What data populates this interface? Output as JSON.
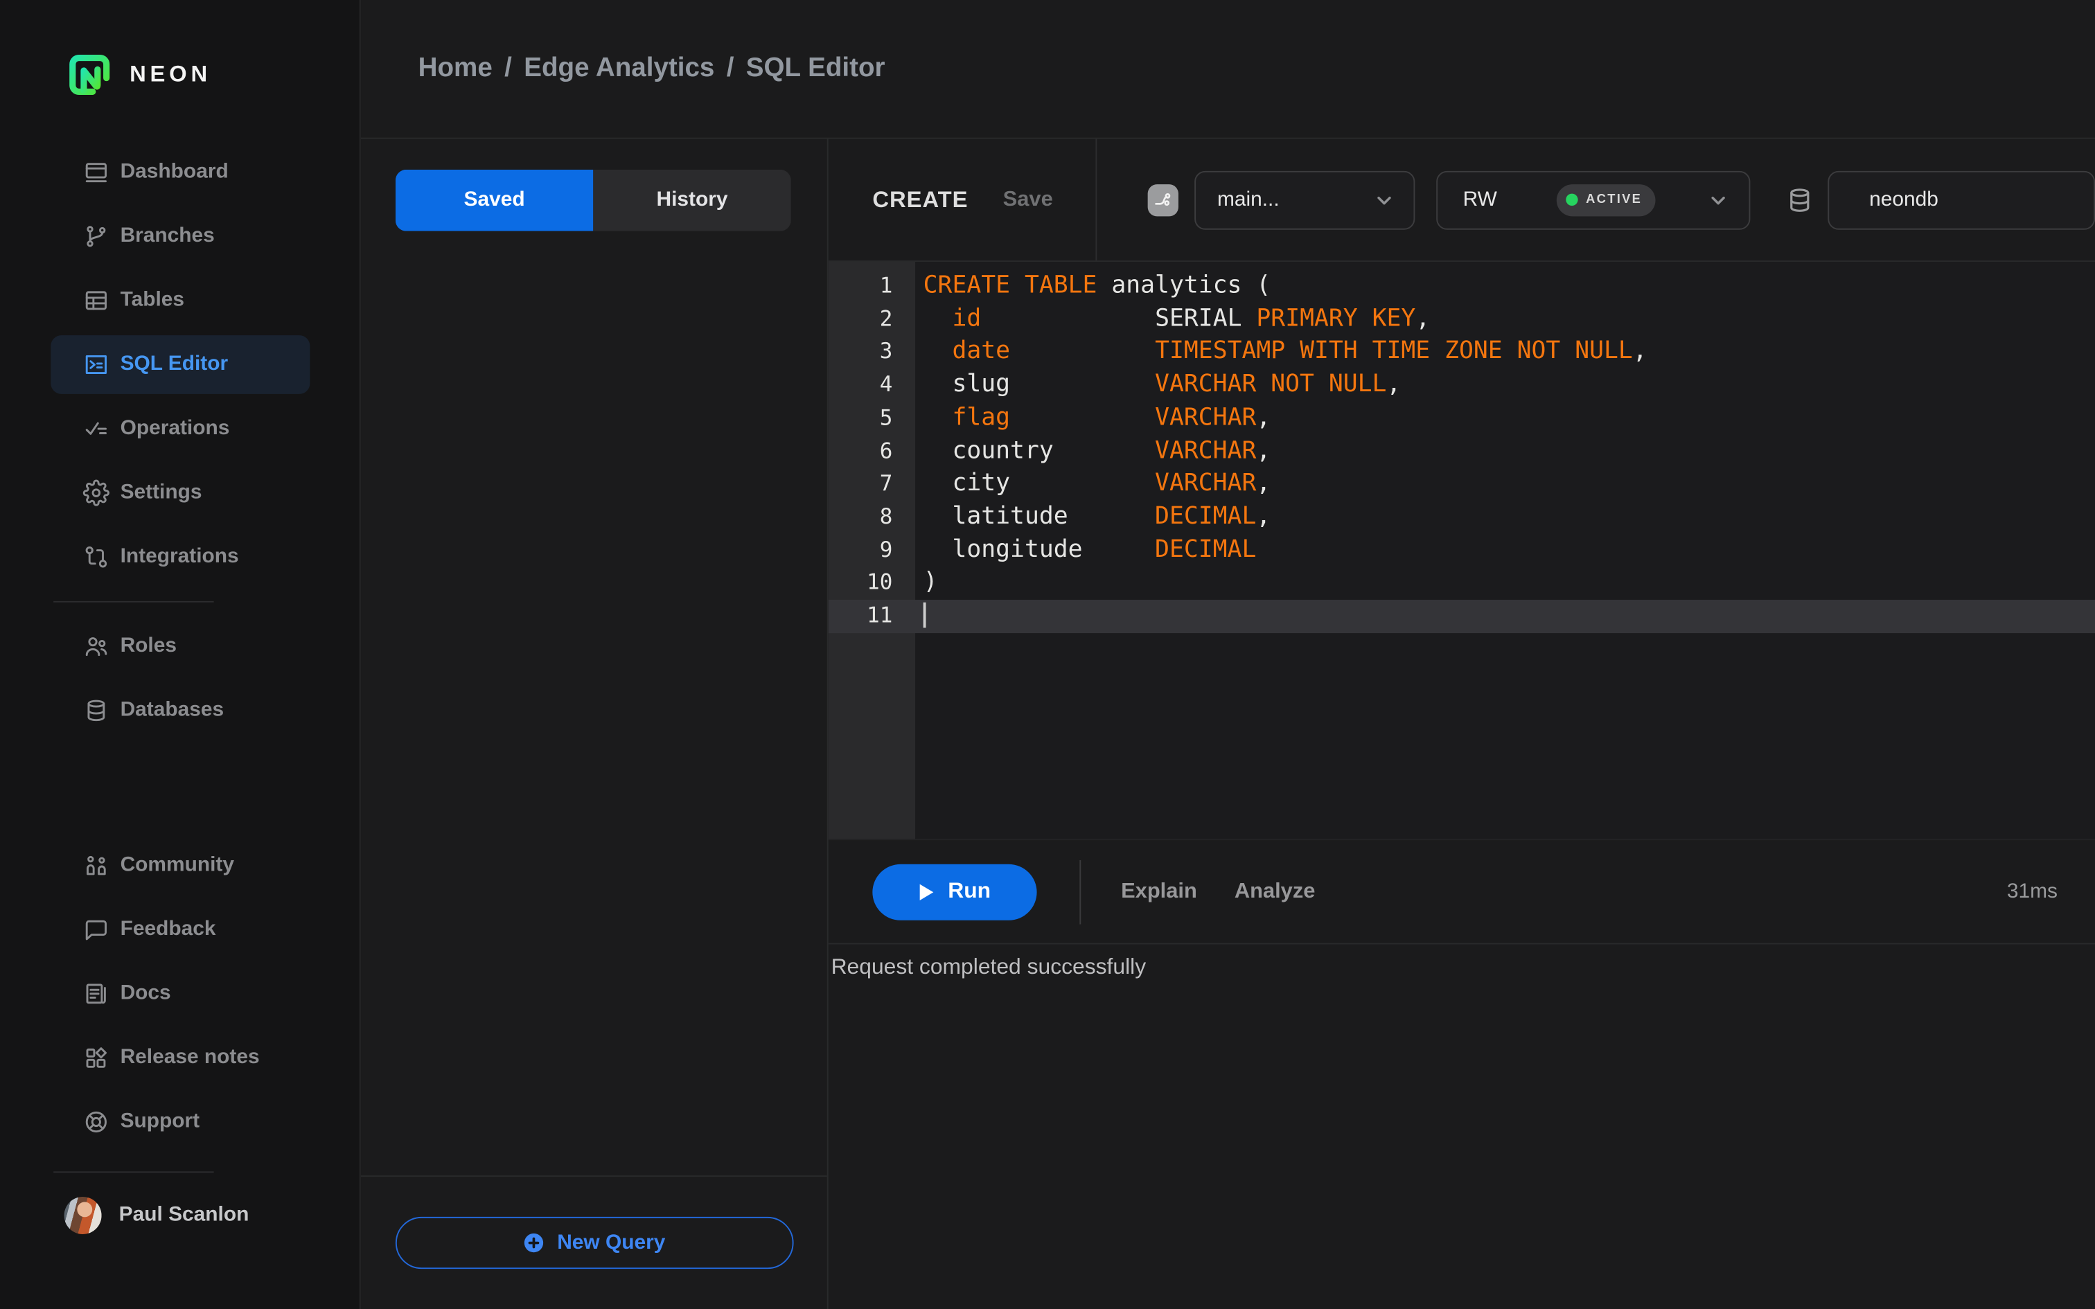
{
  "brand": {
    "name": "NEON"
  },
  "colors": {
    "accent_blue": "#0c6ce4",
    "nav_active_blue": "#4697f2",
    "keyword_orange": "#f4760f",
    "status_green": "#26d45f",
    "logo_gradient_start": "#23e5ac",
    "logo_gradient_end": "#55e632"
  },
  "sidebar": {
    "nav_main": [
      {
        "label": "Dashboard",
        "icon": "dashboard-icon",
        "active": false
      },
      {
        "label": "Branches",
        "icon": "branches-icon",
        "active": false
      },
      {
        "label": "Tables",
        "icon": "tables-icon",
        "active": false
      },
      {
        "label": "SQL Editor",
        "icon": "sql-editor-icon",
        "active": true
      },
      {
        "label": "Operations",
        "icon": "operations-icon",
        "active": false
      },
      {
        "label": "Settings",
        "icon": "settings-icon",
        "active": false
      },
      {
        "label": "Integrations",
        "icon": "integrations-icon",
        "active": false
      }
    ],
    "nav_project": [
      {
        "label": "Roles",
        "icon": "roles-icon",
        "active": false
      },
      {
        "label": "Databases",
        "icon": "databases-icon",
        "active": false
      }
    ],
    "nav_resources": [
      {
        "label": "Community",
        "icon": "community-icon",
        "active": false
      },
      {
        "label": "Feedback",
        "icon": "feedback-icon",
        "active": false
      },
      {
        "label": "Docs",
        "icon": "docs-icon",
        "active": false
      },
      {
        "label": "Release notes",
        "icon": "release-notes-icon",
        "active": false
      },
      {
        "label": "Support",
        "icon": "support-icon",
        "active": false
      }
    ],
    "user": {
      "name": "Paul Scanlon"
    }
  },
  "breadcrumb": {
    "items": [
      "Home",
      "Edge Analytics",
      "SQL Editor"
    ],
    "separator": "/"
  },
  "tabs": {
    "saved": "Saved",
    "history": "History",
    "active": "Saved"
  },
  "query_panel": {
    "new_query_label": "New Query"
  },
  "editor_header": {
    "title": "CREATE",
    "save_label": "Save",
    "branch": "main...",
    "compute": "RW",
    "compute_status": "ACTIVE",
    "database": "neondb"
  },
  "editor": {
    "active_line": 11,
    "lines": [
      {
        "n": 1,
        "t": [
          [
            "CREATE TABLE",
            "k"
          ],
          [
            " analytics (",
            "p"
          ]
        ]
      },
      {
        "n": 2,
        "t": [
          [
            "  ",
            "p"
          ],
          [
            "id",
            "k"
          ],
          [
            "            SERIAL ",
            "p"
          ],
          [
            "PRIMARY KEY",
            "k"
          ],
          [
            ",",
            "p"
          ]
        ]
      },
      {
        "n": 3,
        "t": [
          [
            "  ",
            "p"
          ],
          [
            "date",
            "k"
          ],
          [
            "          ",
            "p"
          ],
          [
            "TIMESTAMP WITH TIME ZONE NOT NULL",
            "k"
          ],
          [
            ",",
            "p"
          ]
        ]
      },
      {
        "n": 4,
        "t": [
          [
            "  slug          ",
            "p"
          ],
          [
            "VARCHAR NOT NULL",
            "k"
          ],
          [
            ",",
            "p"
          ]
        ]
      },
      {
        "n": 5,
        "t": [
          [
            "  ",
            "p"
          ],
          [
            "flag",
            "k"
          ],
          [
            "          ",
            "p"
          ],
          [
            "VARCHAR",
            "k"
          ],
          [
            ",",
            "p"
          ]
        ]
      },
      {
        "n": 6,
        "t": [
          [
            "  country       ",
            "p"
          ],
          [
            "VARCHAR",
            "k"
          ],
          [
            ",",
            "p"
          ]
        ]
      },
      {
        "n": 7,
        "t": [
          [
            "  city          ",
            "p"
          ],
          [
            "VARCHAR",
            "k"
          ],
          [
            ",",
            "p"
          ]
        ]
      },
      {
        "n": 8,
        "t": [
          [
            "  latitude      ",
            "p"
          ],
          [
            "DECIMAL",
            "k"
          ],
          [
            ",",
            "p"
          ]
        ]
      },
      {
        "n": 9,
        "t": [
          [
            "  longitude     ",
            "p"
          ],
          [
            "DECIMAL",
            "k"
          ]
        ]
      },
      {
        "n": 10,
        "t": [
          [
            ")",
            "p"
          ]
        ]
      },
      {
        "n": 11,
        "t": []
      }
    ]
  },
  "toolbar": {
    "run": "Run",
    "explain": "Explain",
    "analyze": "Analyze",
    "duration": "31ms"
  },
  "status_message": "Request completed successfully"
}
